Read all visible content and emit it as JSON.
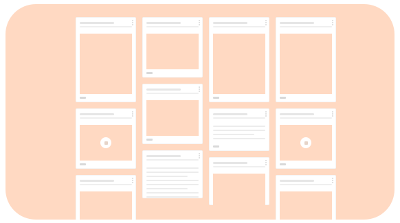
{
  "theme": {
    "background": "#ffd9c2",
    "card": "#ffffff",
    "media": "#ffd9c2"
  },
  "grid": {
    "columns": [
      {
        "cards": [
          {
            "kind": "media-tall",
            "play_icon": false
          },
          {
            "kind": "media-short",
            "play_icon": false
          },
          {
            "kind": "media-cut",
            "play_icon": false
          }
        ]
      },
      {
        "cards": [
          {
            "kind": "media-short-cut",
            "play_icon": false
          },
          {
            "kind": "media-short",
            "play_icon": false
          },
          {
            "kind": "text-lines",
            "play_icon": false
          }
        ]
      },
      {
        "cards": [
          {
            "kind": "media-tall",
            "play_icon": false
          },
          {
            "kind": "text-card",
            "play_icon": false
          },
          {
            "kind": "media-cut",
            "play_icon": false
          }
        ]
      },
      {
        "cards": [
          {
            "kind": "media-tall",
            "play_icon": false
          },
          {
            "kind": "video",
            "play_icon": true
          },
          {
            "kind": "media-cut",
            "play_icon": false
          }
        ]
      }
    ]
  }
}
